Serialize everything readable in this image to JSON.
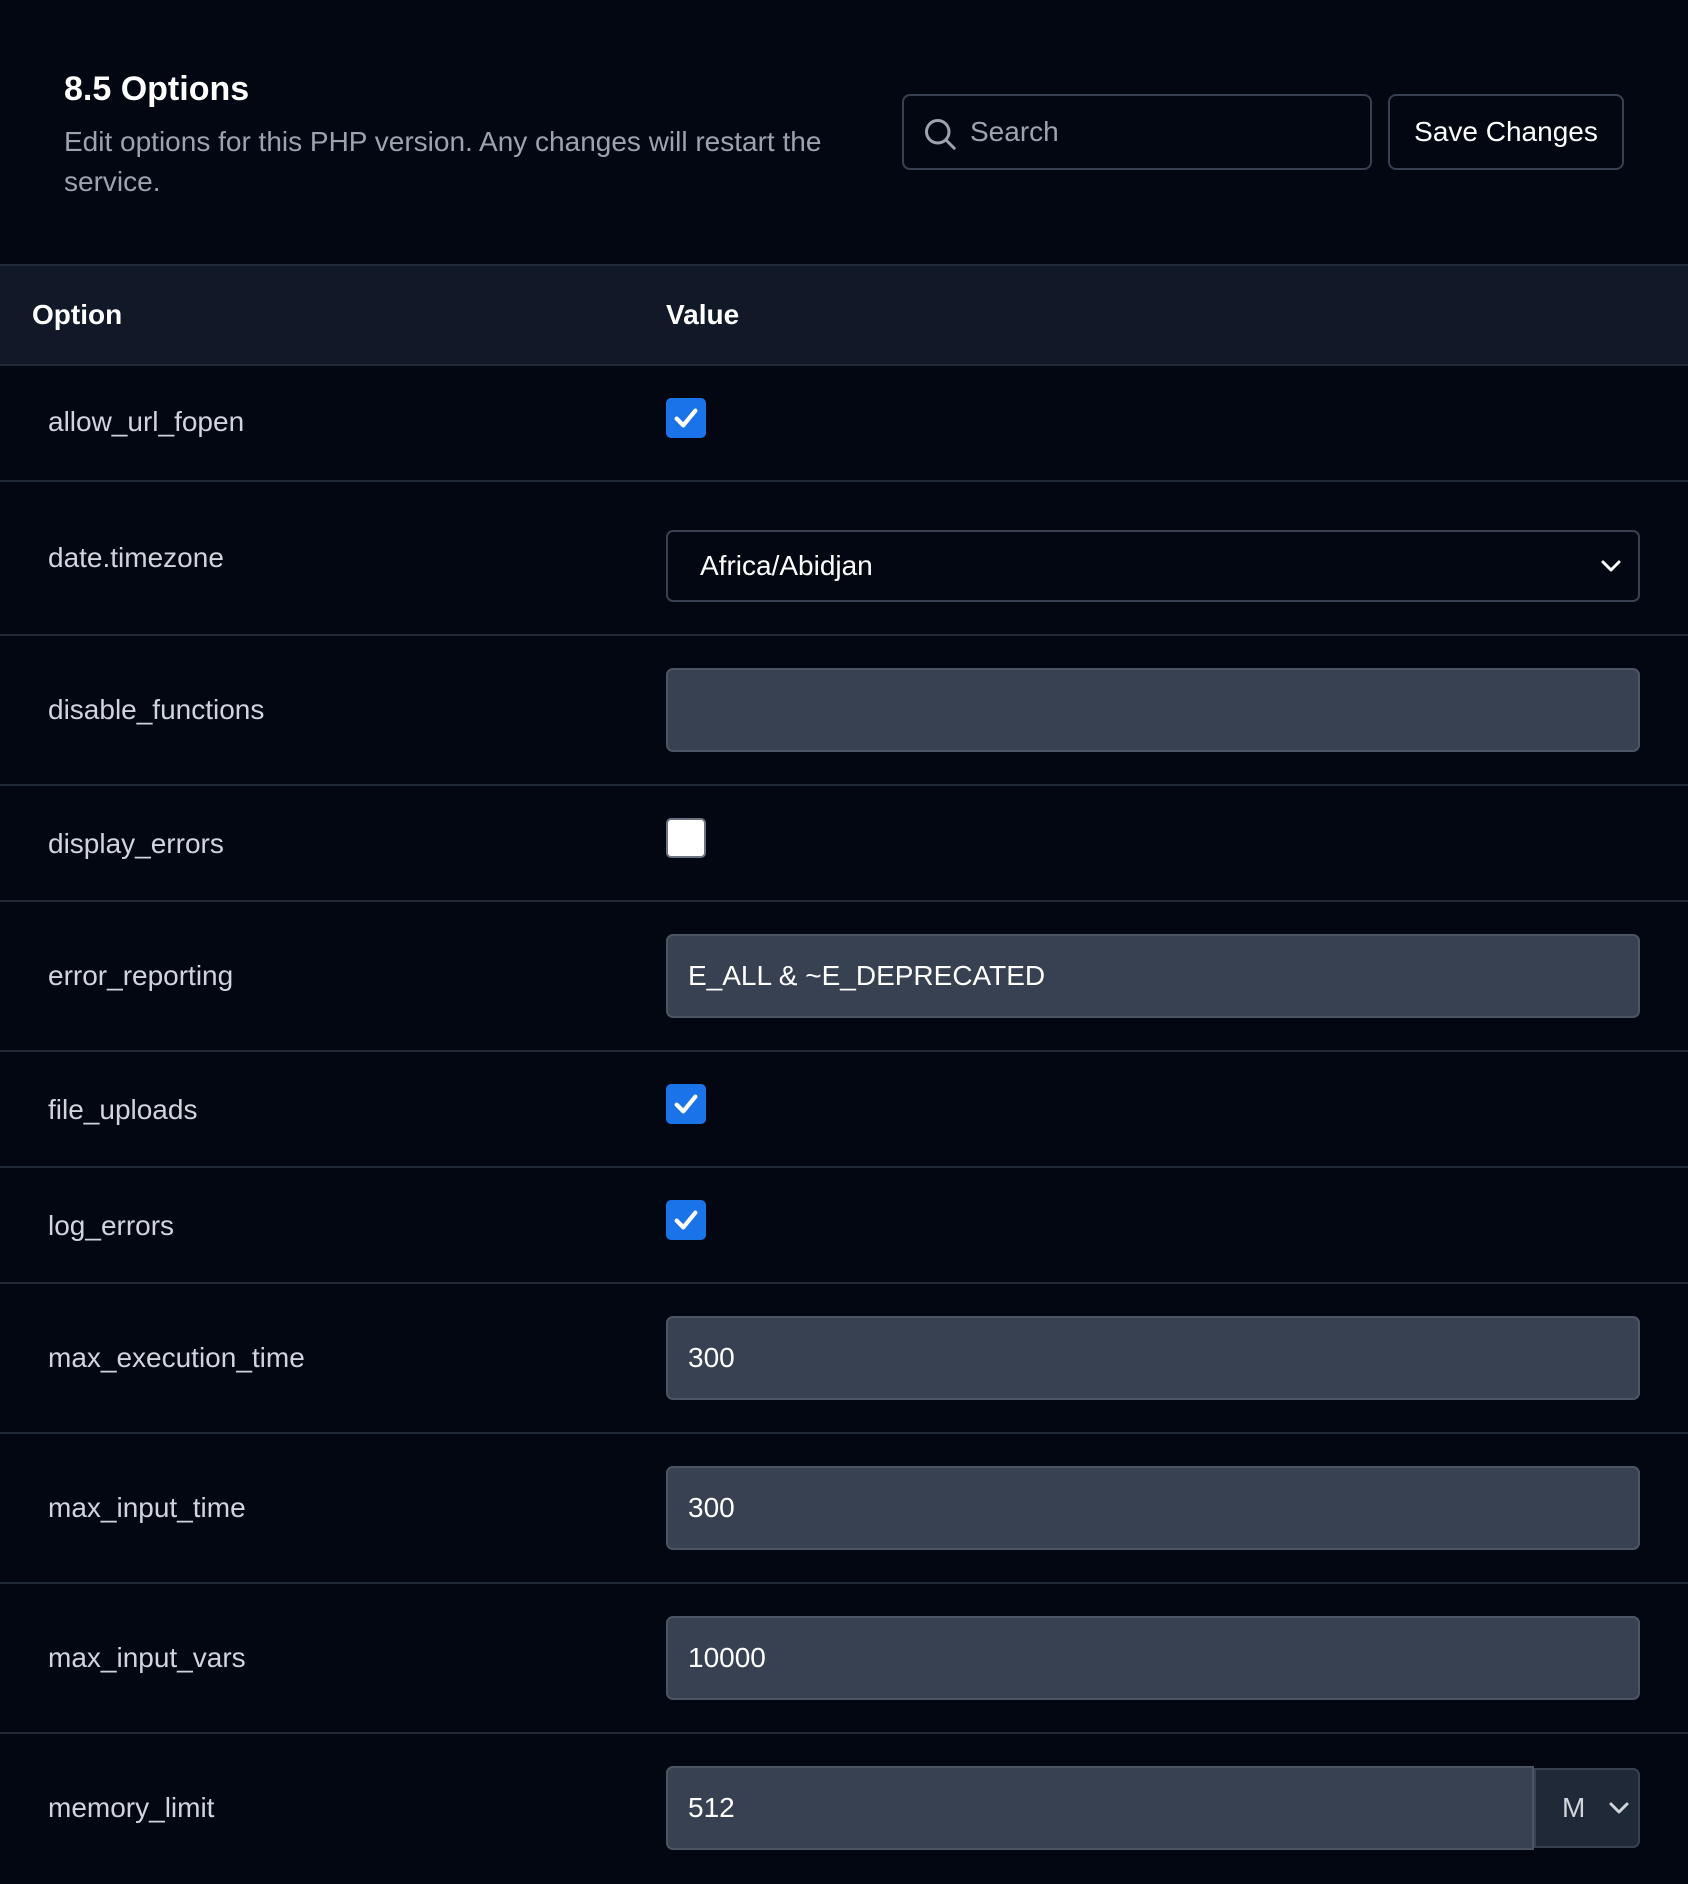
{
  "header": {
    "title": "8.5 Options",
    "description": "Edit options for this PHP version. Any changes will restart the service.",
    "search_placeholder": "Search",
    "search_value": "",
    "save_label": "Save Changes"
  },
  "table": {
    "col_option": "Option",
    "col_value": "Value"
  },
  "options": {
    "allow_url_fopen": {
      "label": "allow_url_fopen",
      "checked": true
    },
    "date_timezone": {
      "label": "date.timezone",
      "value": "Africa/Abidjan"
    },
    "disable_functions": {
      "label": "disable_functions",
      "value": ""
    },
    "display_errors": {
      "label": "display_errors",
      "checked": false
    },
    "error_reporting": {
      "label": "error_reporting",
      "value": "E_ALL & ~E_DEPRECATED"
    },
    "file_uploads": {
      "label": "file_uploads",
      "checked": true
    },
    "log_errors": {
      "label": "log_errors",
      "checked": true
    },
    "max_execution_time": {
      "label": "max_execution_time",
      "value": "300"
    },
    "max_input_time": {
      "label": "max_input_time",
      "value": "300"
    },
    "max_input_vars": {
      "label": "max_input_vars",
      "value": "10000"
    },
    "memory_limit": {
      "label": "memory_limit",
      "value": "512",
      "unit": "M"
    }
  },
  "colors": {
    "background": "#030712",
    "header_row": "#111827",
    "input_bg": "#374151",
    "checkbox_checked": "#1a73e8",
    "muted_text": "#9ca3af"
  }
}
